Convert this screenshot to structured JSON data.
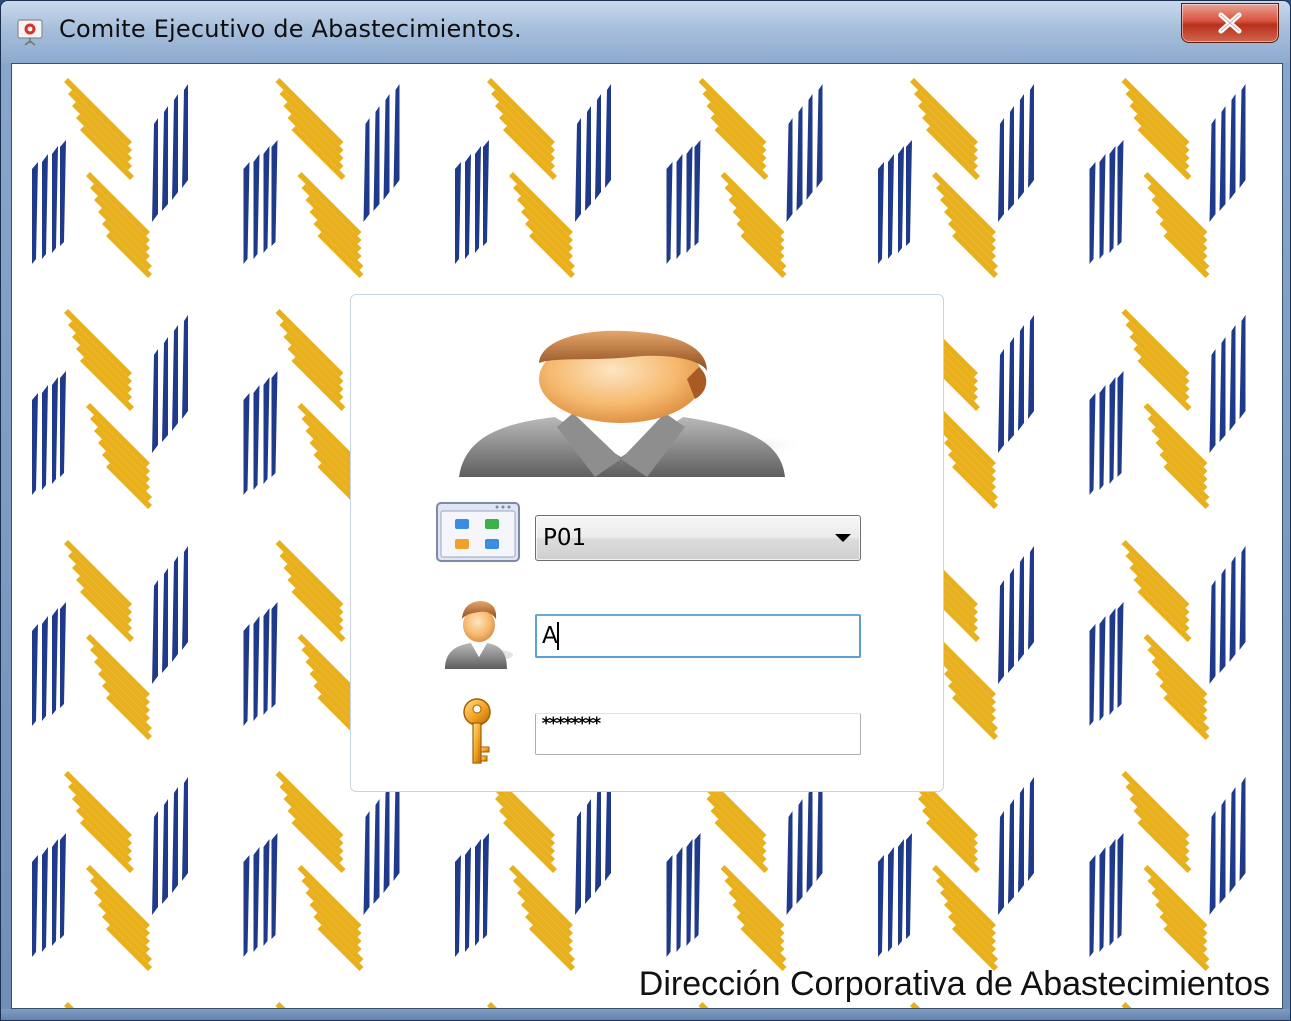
{
  "window": {
    "title": "Comite Ejecutivo de Abastecimientos.",
    "close_icon": "close-icon",
    "app_icon": "presentation-icon"
  },
  "login": {
    "database": {
      "icon": "database-icon",
      "selected_value": "P01"
    },
    "user": {
      "icon": "user-icon",
      "value": "A"
    },
    "password": {
      "icon": "key-icon",
      "masked_value": "********"
    },
    "avatar": "user-avatar-icon"
  },
  "footer": {
    "text": "Dirección Corporativa de Abastecimientos"
  },
  "colors": {
    "logo_blue": "#1f3a8a",
    "logo_gold": "#e8b01c",
    "focus_border": "#5d9fd5",
    "close_red": "#c9402a"
  }
}
